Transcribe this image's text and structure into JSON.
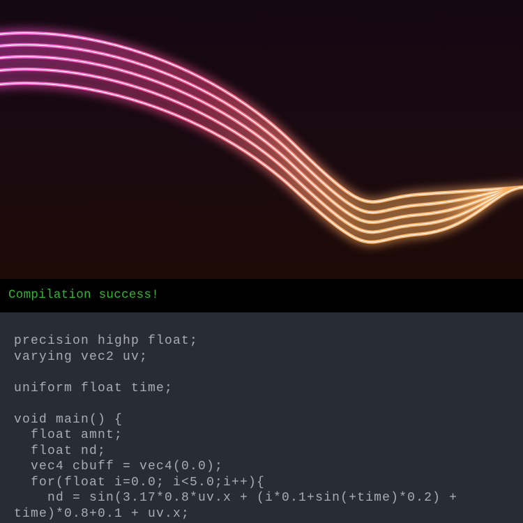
{
  "preview": {
    "colors": {
      "background_top": "#140812",
      "background_bottom": "#1e0a06",
      "line_start": "#ff4fd8",
      "line_end": "#ffb060"
    },
    "line_count": 5
  },
  "status": {
    "message": "Compilation success!",
    "color": "#2fb82f"
  },
  "editor": {
    "lines": [
      "precision highp float;",
      "varying vec2 uv;",
      "",
      "uniform float time;",
      "",
      "void main() {",
      "  float amnt;",
      "  float nd;",
      "  vec4 cbuff = vec4(0.0);",
      "  for(float i=0.0; i<5.0;i++){",
      "    nd = sin(3.17*0.8*uv.x + (i*0.1+sin(+time)*0.2) +",
      "time)*0.8+0.1 + uv.x;"
    ]
  }
}
